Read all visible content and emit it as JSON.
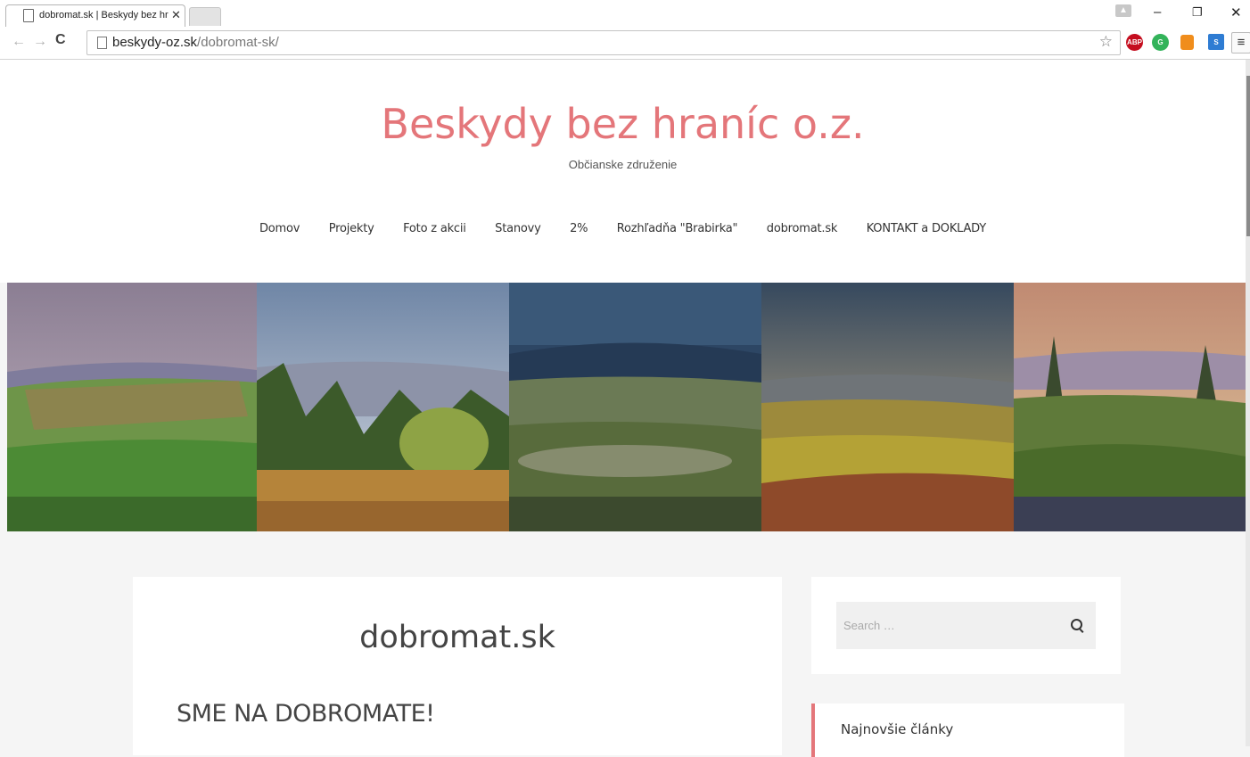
{
  "browser": {
    "tab_title": "dobromat.sk | Beskydy bez hraníc o.z.",
    "url_domain": "beskydy-oz.sk",
    "url_path": "/dobromat-sk/",
    "extensions": [
      "ABP",
      "G",
      "lock",
      "S"
    ]
  },
  "site": {
    "title": "Beskydy bez hraníc o.z.",
    "description": "Občianske združenie",
    "accent_color": "#e4767a"
  },
  "menu": {
    "items": [
      "Domov",
      "Projekty",
      "Foto z akcii",
      "Stanovy",
      "2%",
      "Rozhľadňa \"Brabirka\"",
      "dobromat.sk",
      "KONTAKT a DOKLADY"
    ]
  },
  "post": {
    "title": "dobromat.sk",
    "heading": "SME NA DOBROMATE!"
  },
  "sidebar": {
    "search_placeholder": "Search …",
    "recent_title": "Najnovšie články"
  }
}
